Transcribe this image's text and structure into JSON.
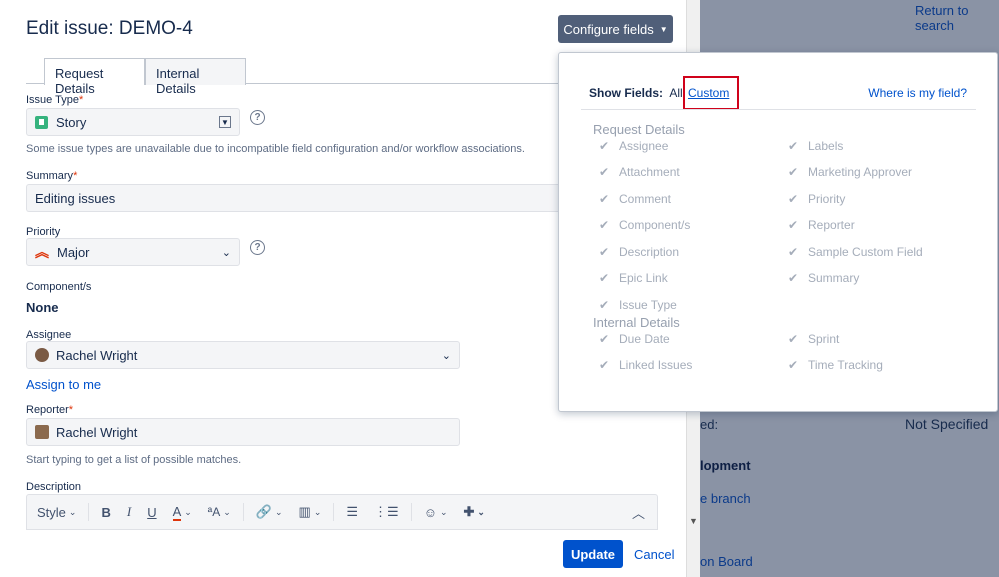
{
  "background": {
    "return_link": "Return to search",
    "not_specified_label": "ed:",
    "not_specified_value": "Not Specified",
    "development_label": "lopment",
    "branch_link": "e branch",
    "board_link": "on Board"
  },
  "modal": {
    "title": "Edit issue: DEMO-4",
    "configure_button": "Configure fields",
    "tabs": [
      {
        "label": "Request Details"
      },
      {
        "label": "Internal Details"
      }
    ],
    "issue_type": {
      "label": "Issue Type",
      "value": "Story",
      "help": "Some issue types are unavailable due to incompatible field configuration and/or workflow associations."
    },
    "summary": {
      "label": "Summary",
      "value": "Editing issues"
    },
    "priority": {
      "label": "Priority",
      "value": "Major"
    },
    "components": {
      "label": "Component/s",
      "value": "None"
    },
    "assignee": {
      "label": "Assignee",
      "value": "Rachel Wright",
      "assign_to_me": "Assign to me"
    },
    "reporter": {
      "label": "Reporter",
      "value": "Rachel Wright",
      "help": "Start typing to get a list of possible matches."
    },
    "description": {
      "label": "Description",
      "style_label": "Style"
    },
    "update_button": "Update",
    "cancel_link": "Cancel"
  },
  "popover": {
    "show_fields": "Show Fields:",
    "all": "All",
    "custom": "Custom",
    "where": "Where is my field?",
    "groups": [
      {
        "title": "Request Details",
        "left": [
          "Assignee",
          "Attachment",
          "Comment",
          "Component/s",
          "Description",
          "Epic Link",
          "Issue Type"
        ],
        "right": [
          "Labels",
          "Marketing Approver",
          "Priority",
          "Reporter",
          "Sample Custom Field",
          "Summary"
        ]
      },
      {
        "title": "Internal Details",
        "left": [
          "Due Date",
          "Linked Issues"
        ],
        "right": [
          "Sprint",
          "Time Tracking"
        ]
      }
    ]
  },
  "colors": {
    "primary": "#0052cc",
    "configure_bg": "#505f79",
    "required": "#de350b",
    "highlight_box": "#d0021b"
  }
}
